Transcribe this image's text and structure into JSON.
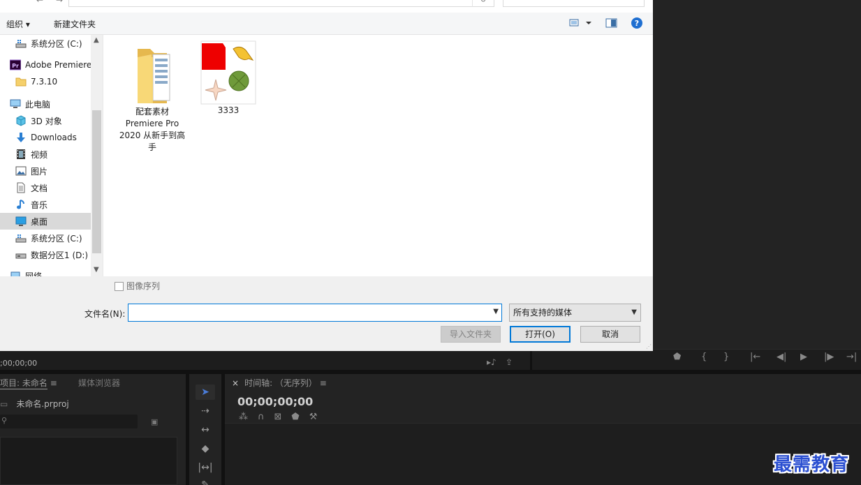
{
  "dialog": {
    "toolbar": {
      "organize_label": "组织 ▾",
      "new_folder_label": "新建文件夹"
    },
    "nav_items": [
      {
        "label": "系统分区 (C:)",
        "icon": "drive-icon"
      },
      {
        "label": "Adobe Premiere",
        "icon": "premiere-icon"
      },
      {
        "label": "7.3.10",
        "icon": "folder-icon"
      },
      {
        "label": "此电脑",
        "icon": "computer-icon"
      },
      {
        "label": "3D 对象",
        "icon": "3d-objects-icon"
      },
      {
        "label": "Downloads",
        "icon": "download-icon"
      },
      {
        "label": "视频",
        "icon": "video-icon"
      },
      {
        "label": "图片",
        "icon": "pictures-icon"
      },
      {
        "label": "文档",
        "icon": "documents-icon"
      },
      {
        "label": "音乐",
        "icon": "music-icon"
      },
      {
        "label": "桌面",
        "icon": "desktop-icon"
      },
      {
        "label": "系统分区 (C:)",
        "icon": "drive-icon"
      },
      {
        "label": "数据分区1 (D:)",
        "icon": "drive-icon"
      },
      {
        "label": "网络",
        "icon": "network-icon"
      }
    ],
    "files": [
      {
        "name": "配套素材\nPremiere Pro\n2020 从新手到高\n手",
        "type": "folder"
      },
      {
        "name": "3333",
        "type": "image"
      }
    ],
    "image_sequence_label": "图像序列",
    "filename_label": "文件名(N):",
    "filename_value": "",
    "filter_value": "所有支持的媒体",
    "import_folder_label": "导入文件夹",
    "open_label": "打开(O)",
    "cancel_label": "取消"
  },
  "premiere": {
    "source_timecode": ";00;00;00",
    "project_tab": "项目: 未命名",
    "media_browser_tab": "媒体浏览器",
    "project_file": "未命名.prproj",
    "timeline_tab": "时间轴: （无序列）",
    "timeline_timecode": "00;00;00;00"
  },
  "watermark": "最需教育",
  "colors": {
    "accent": "#0078d7",
    "panel_bg": "#232323",
    "watermark": "#2b4fd1"
  }
}
